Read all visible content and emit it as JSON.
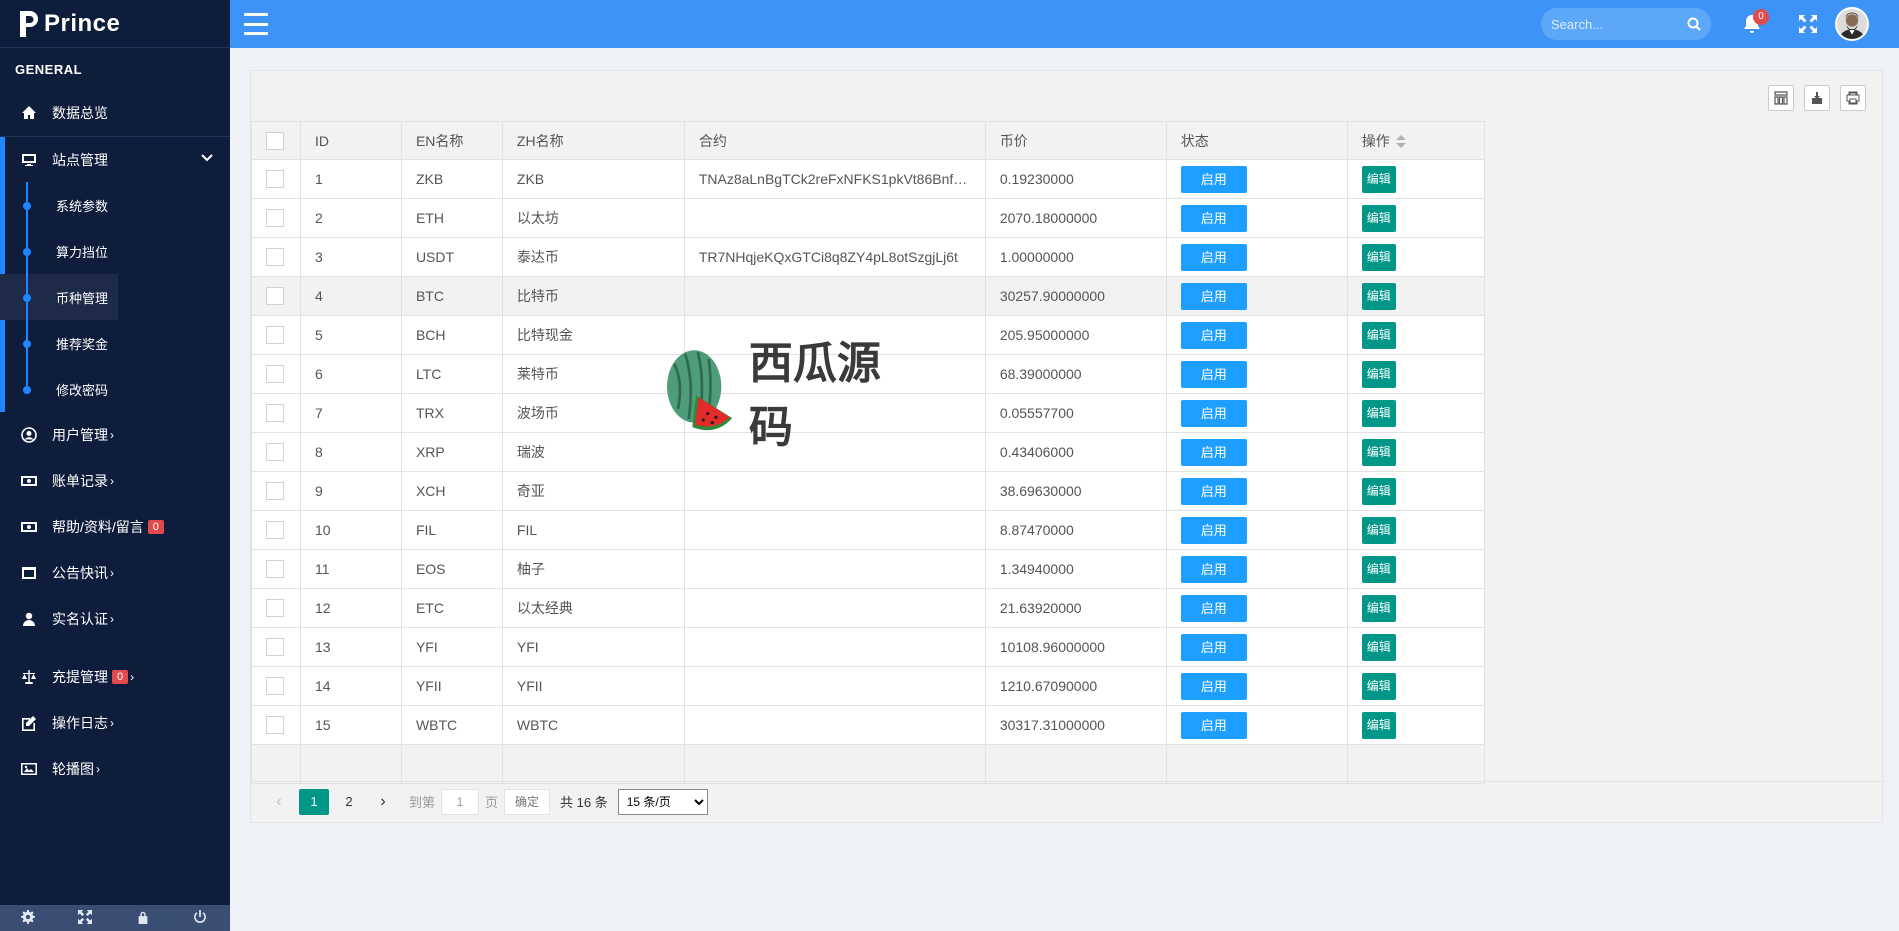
{
  "brand": {
    "name": "Prince"
  },
  "sidebar": {
    "section": "GENERAL",
    "items": [
      {
        "label": "数据总览",
        "icon": "home-icon"
      },
      {
        "label": "站点管理",
        "icon": "monitor-icon",
        "open": true,
        "children": [
          "系统参数",
          "算力挡位",
          "币种管理",
          "推荐奖金",
          "修改密码"
        ]
      },
      {
        "label": "用户管理",
        "icon": "user-circle-icon"
      },
      {
        "label": "账单记录",
        "icon": "money-icon"
      },
      {
        "label": "帮助/资料/留言",
        "icon": "money-icon",
        "badge": "0"
      },
      {
        "label": "公告快讯",
        "icon": "window-icon"
      },
      {
        "label": "实名认证",
        "icon": "user-icon"
      },
      {
        "label": "充提管理",
        "icon": "balance-icon",
        "badge": "0"
      },
      {
        "label": "操作日志",
        "icon": "edit-icon"
      },
      {
        "label": "轮播图",
        "icon": "image-icon"
      }
    ],
    "active_child": "币种管理"
  },
  "topbar": {
    "search_placeholder": "Search...",
    "notification_count": "0"
  },
  "table": {
    "columns": [
      "ID",
      "EN名称",
      "ZH名称",
      "合约",
      "币价",
      "状态",
      "操作"
    ],
    "status_label": "启用",
    "edit_label": "编辑",
    "rows": [
      {
        "id": "1",
        "en": "ZKB",
        "zh": "ZKB",
        "contract": "TNAz8aLnBgTCk2reFxNFKS1pkVt86Bnf…",
        "price": "0.19230000"
      },
      {
        "id": "2",
        "en": "ETH",
        "zh": "以太坊",
        "contract": "",
        "price": "2070.18000000"
      },
      {
        "id": "3",
        "en": "USDT",
        "zh": "泰达币",
        "contract": "TR7NHqjeKQxGTCi8q8ZY4pL8otSzgjLj6t",
        "price": "1.00000000"
      },
      {
        "id": "4",
        "en": "BTC",
        "zh": "比特币",
        "contract": "",
        "price": "30257.90000000"
      },
      {
        "id": "5",
        "en": "BCH",
        "zh": "比特现金",
        "contract": "",
        "price": "205.95000000"
      },
      {
        "id": "6",
        "en": "LTC",
        "zh": "莱特币",
        "contract": "",
        "price": "68.39000000"
      },
      {
        "id": "7",
        "en": "TRX",
        "zh": "波场币",
        "contract": "",
        "price": "0.05557700"
      },
      {
        "id": "8",
        "en": "XRP",
        "zh": "瑞波",
        "contract": "",
        "price": "0.43406000"
      },
      {
        "id": "9",
        "en": "XCH",
        "zh": "奇亚",
        "contract": "",
        "price": "38.69630000"
      },
      {
        "id": "10",
        "en": "FIL",
        "zh": "FIL",
        "contract": "",
        "price": "8.87470000"
      },
      {
        "id": "11",
        "en": "EOS",
        "zh": "柚子",
        "contract": "",
        "price": "1.34940000"
      },
      {
        "id": "12",
        "en": "ETC",
        "zh": "以太经典",
        "contract": "",
        "price": "21.63920000"
      },
      {
        "id": "13",
        "en": "YFI",
        "zh": "YFI",
        "contract": "",
        "price": "10108.96000000"
      },
      {
        "id": "14",
        "en": "YFII",
        "zh": "YFII",
        "contract": "",
        "price": "1210.67090000"
      },
      {
        "id": "15",
        "en": "WBTC",
        "zh": "WBTC",
        "contract": "",
        "price": "30317.31000000"
      }
    ]
  },
  "pager": {
    "pages": [
      "1",
      "2"
    ],
    "current": "1",
    "goto_label": "到第",
    "goto_value": "1",
    "page_unit": "页",
    "confirm": "确定",
    "total": "共 16 条",
    "per_page": "15 条/页"
  },
  "watermark": {
    "text": "西瓜源码"
  },
  "colors": {
    "sidebar": "#0f1d3c",
    "topbar": "#3d94f6",
    "accent": "#1e86ff",
    "status_btn": "#1e9fff",
    "edit_btn": "#009688"
  }
}
